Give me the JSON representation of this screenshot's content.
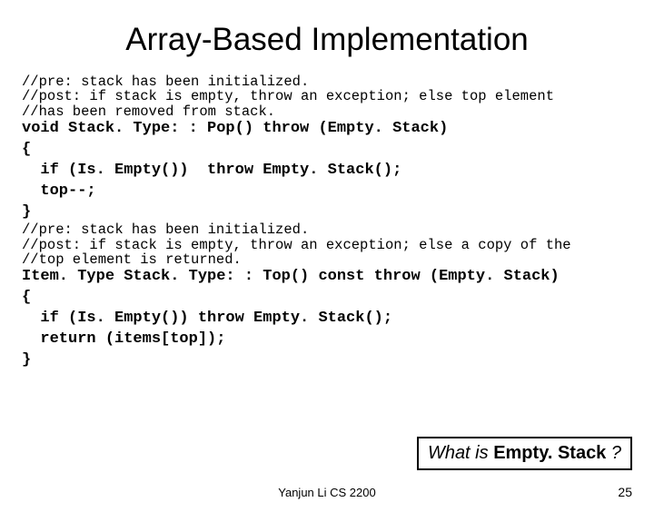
{
  "title": "Array-Based Implementation",
  "comment1_l1": "//pre: stack has been initialized.",
  "comment1_l2": "//post: if stack is empty, throw an exception; else top element",
  "comment1_l3": "//has been removed from stack.",
  "code1_l1": "void Stack. Type: : Pop() throw (Empty. Stack)",
  "code1_l2": "{",
  "code1_l3": "  if (Is. Empty())  throw Empty. Stack();",
  "code1_l4": "  top--;",
  "code1_l5": "}",
  "comment2_l1": "//pre: stack has been initialized.",
  "comment2_l2": "//post: if stack is empty, throw an exception; else a copy of the",
  "comment2_l3": "//top element is returned.",
  "code2_l1": "Item. Type Stack. Type: : Top() const throw (Empty. Stack)",
  "code2_l2": "{",
  "code2_l3": "  if (Is. Empty()) throw Empty. Stack();",
  "code2_l4": "  return (items[top]);",
  "code2_l5": "}",
  "callout_prefix": "What is ",
  "callout_term": "Empty. Stack",
  "callout_suffix": " ?",
  "footer_center": "Yanjun Li CS 2200",
  "footer_right": "25"
}
